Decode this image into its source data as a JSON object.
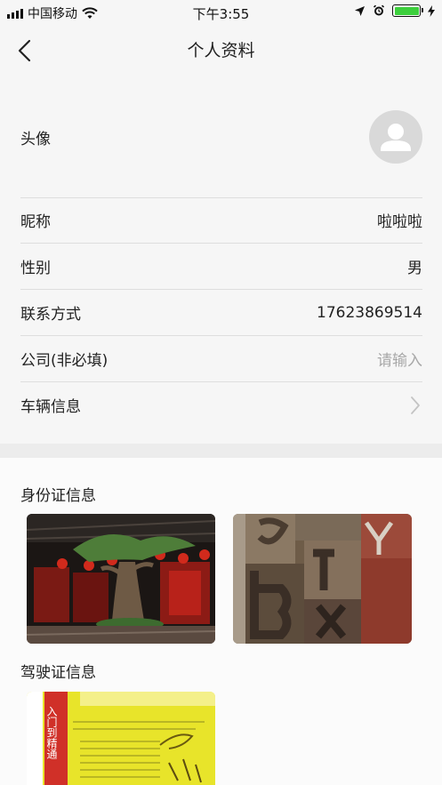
{
  "status_bar": {
    "carrier": "中国移动",
    "time": "下午3:55",
    "battery_level": 1.0
  },
  "nav": {
    "title": "个人资料",
    "back_icon": "chevron-left-icon"
  },
  "profile": {
    "avatar_label": "头像",
    "avatar_icon": "user-avatar-icon",
    "rows": [
      {
        "label": "昵称",
        "value": "啦啦啦"
      },
      {
        "label": "性别",
        "value": "男"
      },
      {
        "label": "联系方式",
        "value": "17623869514"
      },
      {
        "label": "公司(非必填)",
        "placeholder": "请输入"
      },
      {
        "label": "车辆信息",
        "icon": "chevron-right-icon"
      }
    ]
  },
  "id_section": {
    "title": "身份证信息"
  },
  "license_section": {
    "title": "驾驶证信息",
    "image_text": "入门到精通"
  },
  "colors": {
    "background": "#f6f6f6",
    "divider": "#dedede",
    "placeholder": "#a8a8a8",
    "battery": "#3ccf3c"
  }
}
